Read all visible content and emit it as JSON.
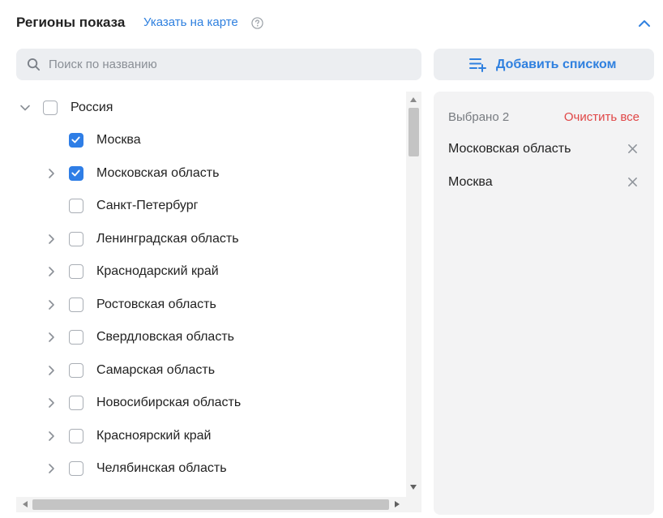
{
  "header": {
    "title": "Регионы показа",
    "map_link": "Указать на карте",
    "accent_color": "#2f80df"
  },
  "search": {
    "placeholder": "Поиск по названию",
    "value": ""
  },
  "add_list_button": {
    "label": "Добавить списком"
  },
  "tree": {
    "root": {
      "label": "Россия",
      "checked": false,
      "expanded": true
    },
    "items": [
      {
        "label": "Москва",
        "checked": true,
        "expandable": false
      },
      {
        "label": "Московская область",
        "checked": true,
        "expandable": true
      },
      {
        "label": "Санкт-Петербург",
        "checked": false,
        "expandable": false
      },
      {
        "label": "Ленинградская область",
        "checked": false,
        "expandable": true
      },
      {
        "label": "Краснодарский край",
        "checked": false,
        "expandable": true
      },
      {
        "label": "Ростовская область",
        "checked": false,
        "expandable": true
      },
      {
        "label": "Свердловская область",
        "checked": false,
        "expandable": true
      },
      {
        "label": "Самарская область",
        "checked": false,
        "expandable": true
      },
      {
        "label": "Новосибирская область",
        "checked": false,
        "expandable": true
      },
      {
        "label": "Красноярский край",
        "checked": false,
        "expandable": true
      },
      {
        "label": "Челябинская область",
        "checked": false,
        "expandable": true
      }
    ]
  },
  "selected": {
    "count_label": "Выбрано 2",
    "clear_label": "Очистить все",
    "clear_color": "#e04646",
    "items": [
      {
        "label": "Московская область"
      },
      {
        "label": "Москва"
      }
    ]
  }
}
